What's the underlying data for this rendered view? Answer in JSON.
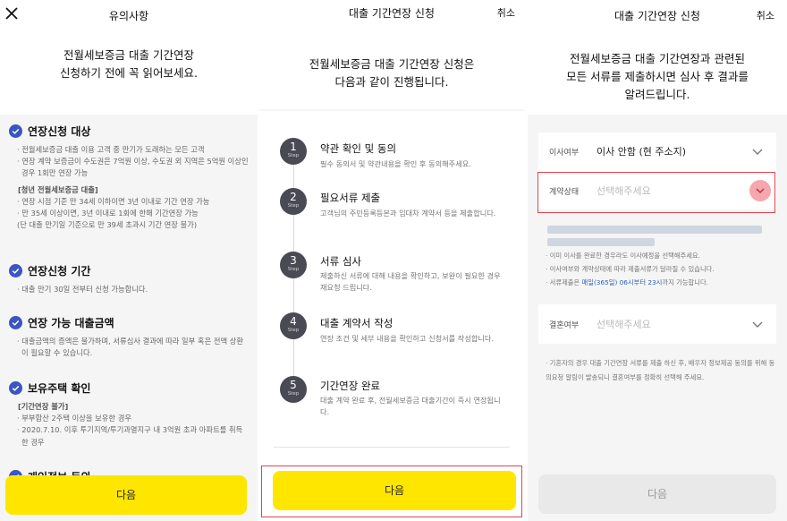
{
  "panel1": {
    "title": "유의사항",
    "intro": "전월세보증금 대출 기간연장\n신청하기 전에 꼭 읽어보세요.",
    "sections": [
      {
        "heading": "연장신청 대상",
        "notes": [
          "· 전월세보증금 대출 이용 고객 중 만기가 도래하는 모든 고객",
          "· 연장 계약 보증금이 수도권은 7억원 이상, 수도권 외 지역은 5억원 이상인 경우 1회만 연장 가능"
        ],
        "sub": "[청년 전월세보증금 대출]",
        "subnotes": [
          "· 연장 시점 기준 만 34세 이하이면 3년 이내로 기간 연장 가능",
          "· 만 35세 이상이면, 3년 이내로 1회에 한해 기간연장 가능",
          "(단 대출 만기일 기준으로 만 39세 초과시 기간 연장 불가)"
        ]
      },
      {
        "heading": "연장신청 기간",
        "notes": [
          "· 대출 만기 30일 전부터 신청 가능합니다."
        ]
      },
      {
        "heading": "연장 가능 대출금액",
        "notes": [
          "· 대출금액의 증액은 불가하며, 서류심사 결과에 따라 일부 혹은 전액 상환이 필요할 수 있습니다."
        ]
      },
      {
        "heading": "보유주택 확인",
        "sub": "[기간연장 불가]",
        "subnotes": [
          "· 부부합산 2주택 이상을 보유한 경우",
          "· 2020.7.10. 이후 투기지역/투기과열지구 내 3억원 초과 아파트를 취득한 경우"
        ]
      },
      {
        "heading": "개인정보 동의"
      }
    ],
    "next_label": "다음"
  },
  "panel2": {
    "title": "대출 기간연장 신청",
    "cancel_label": "취소",
    "intro": "전월세보증금 대출 기간연장 신청은\n다음과 같이 진행됩니다.",
    "step_label": "Step",
    "steps": [
      {
        "num": "1",
        "title": "약관 확인 및 동의",
        "desc": "필수 동의서 및 약관내용을 확인 후 동의해주세요."
      },
      {
        "num": "2",
        "title": "필요서류 제출",
        "desc": "고객님의 주민등록등본과 임대차 계약서 등을 제출합니다."
      },
      {
        "num": "3",
        "title": "서류 심사",
        "desc": "제출하신 서류에 대해 내용을 확인하고, 보완이 필요한 경우 재요청 드립니다."
      },
      {
        "num": "4",
        "title": "대출 계약서 작성",
        "desc": "연장 조건 및 세부 내용을 확인하고 신청서를 작성합니다."
      },
      {
        "num": "5",
        "title": "기간연장 완료",
        "desc": "대출 계약 완료 후, 전월세보증금 대출기간이 즉시 연장됩니다."
      }
    ],
    "next_label": "다음"
  },
  "panel3": {
    "title": "대출 기간연장 신청",
    "cancel_label": "취소",
    "intro": "전월세보증금 대출 기간연장과 관련된\n모든 서류를 제출하시면 심사 후 결과를\n알려드립니다.",
    "move": {
      "label": "이사여부",
      "value": "이사 안함 (현 주소지)"
    },
    "contract": {
      "label": "계약상태",
      "placeholder": "선택해주세요"
    },
    "info_lines": [
      "· 이미 이사를 완료한 경우라도 이사예정을 선택해주세요.",
      "· 이사여부와 계약상태에 따라 제출서류가 달라질 수 있습니다."
    ],
    "info_submit_prefix": "· 서류제출은 ",
    "info_submit_time": "매일(365일) 06시부터 23시",
    "info_submit_suffix": "까지 가능합니다.",
    "marriage": {
      "label": "결혼여부",
      "placeholder": "선택해주세요"
    },
    "marriage_note": "· 기혼자의 경우 대출 기간연장 서류를 제출 하신 후, 배우자 정보제공 동의를 위해 동의요청 알림이 발송되니 결혼여부를 정확히 선택해 주세요.",
    "next_label": "다음"
  },
  "colors": {
    "accent": "#ffe600",
    "highlight": "#e0454e",
    "check": "#3a55c4",
    "link": "#2a5fb8"
  }
}
